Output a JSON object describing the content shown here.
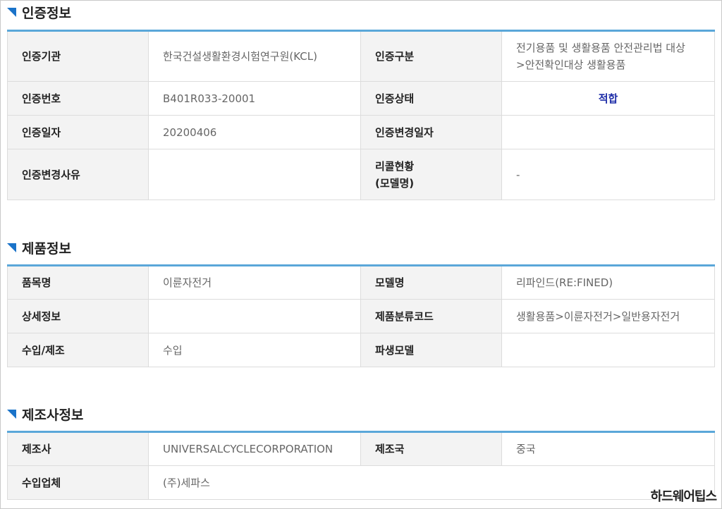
{
  "cert": {
    "title": "인증정보",
    "rows": [
      [
        {
          "k": "인증기관"
        },
        {
          "v": "한국건설생활환경시험연구원(KCL)"
        },
        {
          "k": "인증구분"
        },
        {
          "v": "전기용품 및 생활용품 안전관리법 대상 >안전확인대상 생활용품"
        }
      ],
      [
        {
          "k": "인증번호"
        },
        {
          "v": "B401R033-20001"
        },
        {
          "k": "인증상태"
        },
        {
          "v": "적합"
        }
      ],
      [
        {
          "k": "인증일자"
        },
        {
          "v": "20200406"
        },
        {
          "k": "인증변경일자"
        },
        {
          "v": ""
        }
      ],
      [
        {
          "k": "인증변경사유"
        },
        {
          "v": ""
        },
        {
          "k": "리콜현황 (모델명)"
        },
        {
          "v": "-"
        }
      ]
    ],
    "labels": {
      "agency": "인증기관",
      "agency_val": "한국건설생활환경시험연구원(KCL)",
      "type": "인증구분",
      "type_val_1": "전기용품 및 생활용품 안전관리법 대상",
      "type_val_2": ">안전확인대상 생활용품",
      "number": "인증번호",
      "number_val": "B401R033-20001",
      "status": "인증상태",
      "status_val": "적합",
      "date": "인증일자",
      "date_val": "20200406",
      "change_date": "인증변경일자",
      "change_date_val": "",
      "change_reason": "인증변경사유",
      "change_reason_val": "",
      "recall_1": "리콜현황",
      "recall_2": "(모델명)",
      "recall_val": "-"
    },
    "status_color": "#1f2ea8"
  },
  "product": {
    "title": "제품정보",
    "labels": {
      "item": "품목명",
      "item_val": "이륜자전거",
      "model": "모델명",
      "model_val": "리파인드(RE:FINED)",
      "detail": "상세정보",
      "detail_val": "",
      "category_code": "제품분류코드",
      "category_code_val": "생활용품>이륜자전거>일반용자전거",
      "import_make": "수입/제조",
      "import_make_val": "수입",
      "derived_model": "파생모델",
      "derived_model_val": ""
    }
  },
  "maker": {
    "title": "제조사정보",
    "labels": {
      "maker": "제조사",
      "maker_val": "UNIVERSALCYCLECORPORATION",
      "country": "제조국",
      "country_val": "중국",
      "importer": "수입업체",
      "importer_val": "(주)세파스"
    }
  },
  "watermark": "하드웨어팁스",
  "accent_color": "#1a73c9",
  "table_top_border_color": "#5aa7d9"
}
